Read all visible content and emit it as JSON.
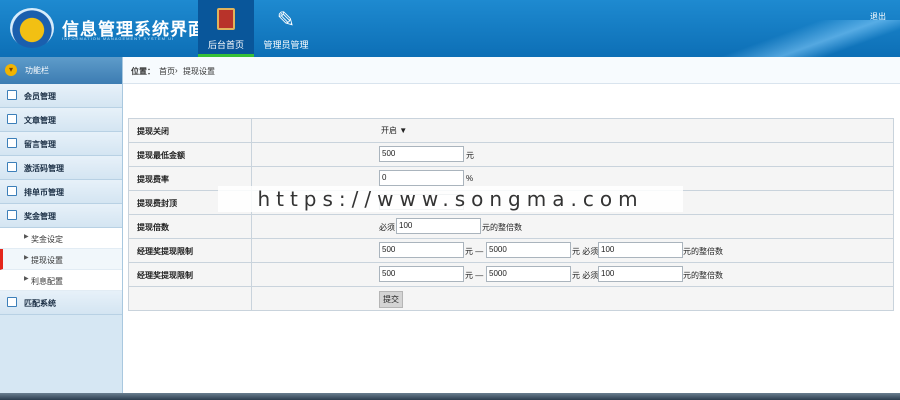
{
  "header": {
    "title": "信息管理系统界面",
    "subtitle": "INFORMATION MANAGEMENT SYSTEM UI",
    "logout": "退出",
    "nav": [
      {
        "label": "后台首页",
        "icon": "book-icon",
        "active": true
      },
      {
        "label": "管理员管理",
        "icon": "tools-icon",
        "active": false
      }
    ]
  },
  "sidebar": {
    "header": "功能栏",
    "items": [
      {
        "label": "会员管理",
        "icon": "list-icon"
      },
      {
        "label": "文章管理",
        "icon": "edit-icon"
      },
      {
        "label": "留言管理",
        "icon": "edit-icon"
      },
      {
        "label": "激活码管理",
        "icon": "calendar-icon"
      },
      {
        "label": "排单币管理",
        "icon": "calendar-icon"
      },
      {
        "label": "奖金管理",
        "icon": "calendar-icon"
      }
    ],
    "subitems": [
      {
        "label": "奖金设定",
        "active": false
      },
      {
        "label": "提现设置",
        "active": true
      },
      {
        "label": "利息配置",
        "active": false
      }
    ],
    "last_item": {
      "label": "匹配系统",
      "icon": "list-icon"
    }
  },
  "breadcrumb": {
    "prefix": "位置：",
    "home": "首页",
    "sep": "›",
    "current": "提现设置"
  },
  "form": {
    "rows": [
      {
        "label": "提现关闭",
        "select_value": "开启",
        "select_arrow": "▼"
      },
      {
        "label": "提现最低金额",
        "value": "500",
        "unit": "元"
      },
      {
        "label": "提现费率",
        "value": "0",
        "unit": "%"
      },
      {
        "label": "提现费封顶"
      },
      {
        "label": "提现倍数",
        "prefix": "必须",
        "value": "100",
        "suffix": "元的整倍数"
      },
      {
        "label": "经理奖提现限制",
        "min": "500",
        "unit1": "元 —",
        "max": "5000",
        "unit2": "元 必须",
        "multiple": "100",
        "suffix": "元的整倍数"
      },
      {
        "label": "经理奖提现限制",
        "min": "500",
        "unit1": "元 —",
        "max": "5000",
        "unit2": "元 必须",
        "multiple": "100",
        "suffix": "元的整倍数"
      }
    ],
    "submit_label": "提交"
  },
  "watermark": "https://www.songma.com"
}
